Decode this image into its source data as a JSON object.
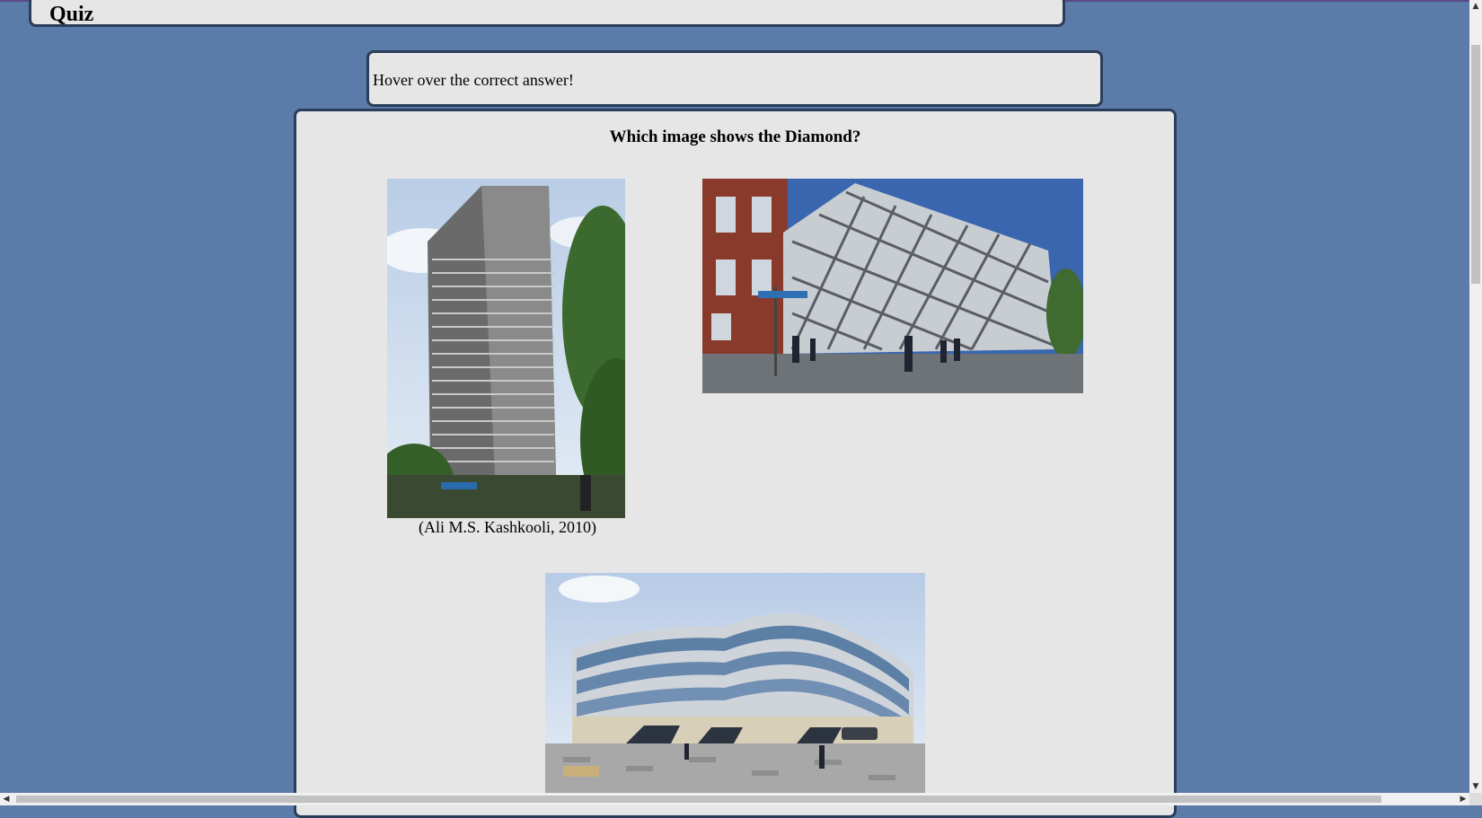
{
  "header": {
    "title": "Quiz"
  },
  "instruction": {
    "text": "Hover over the correct answer!"
  },
  "quiz": {
    "question": "Which image shows the Diamond?",
    "options": [
      {
        "name": "arts-tower-image",
        "caption": "(Ali M.S. Kashkooli, 2010)"
      },
      {
        "name": "diamond-building-image",
        "caption": ""
      },
      {
        "name": "curved-glass-building-image",
        "caption": ""
      }
    ]
  },
  "colors": {
    "page_background": "#5b7ba8",
    "panel_background": "#e6e6e6",
    "panel_border": "#2a3d5a"
  }
}
